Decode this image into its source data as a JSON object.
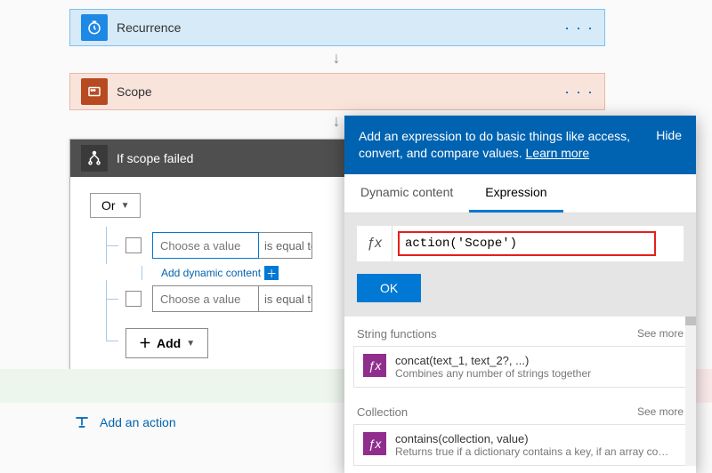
{
  "recurrence": {
    "label": "Recurrence"
  },
  "scope": {
    "label": "Scope"
  },
  "ifscope": {
    "title": "If scope failed",
    "or_label": "Or",
    "rows": [
      {
        "placeholder": "Choose a value",
        "op": "is equal to"
      },
      {
        "placeholder": "Choose a value",
        "op": "is equal to"
      }
    ],
    "add_dynamic": "Add dynamic content",
    "add_button": "Add"
  },
  "add_action": "Add an action",
  "panel": {
    "help_text": "Add an expression to do basic things like access, convert, and compare values.",
    "learn_more": "Learn more",
    "hide": "Hide",
    "tabs": {
      "dynamic": "Dynamic content",
      "expression": "Expression"
    },
    "expression_value": "action('Scope')",
    "ok": "OK",
    "sections": [
      {
        "title": "String functions",
        "see_more": "See more",
        "fn": {
          "signature": "concat(text_1, text_2?, ...)",
          "desc": "Combines any number of strings together"
        }
      },
      {
        "title": "Collection",
        "see_more": "See more",
        "fn": {
          "signature": "contains(collection, value)",
          "desc": "Returns true if a dictionary contains a key, if an array cont..."
        }
      }
    ]
  }
}
